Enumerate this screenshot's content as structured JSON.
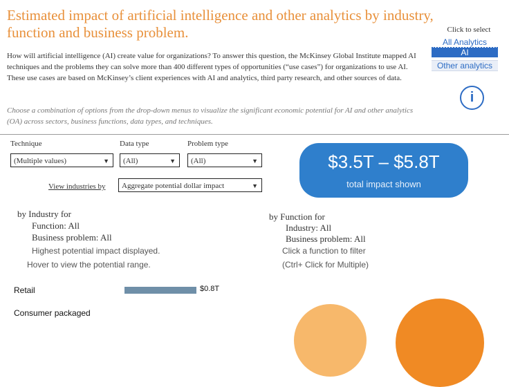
{
  "title": "Estimated impact of artificial intelligence and other analytics by industry, function and business problem.",
  "intro": "How will artificial intelligence (AI) create value for organizations? To answer this question, the McKinsey Global Institute mapped AI techniques and the problems they can solve more than 400 different types of opportunities (“use cases”) for organizations to use AI. These use cases are based on McKinsey’s client experiences with AI and analytics, third party research, and other sources of data.",
  "hint": "Choose a combination of options from the drop-down menus to visualize the significant economic potential for AI and other analytics (OA) across sectors, business functions, data types, and techniques.",
  "selector": {
    "caption": "Click to select",
    "options": [
      "All Analytics",
      "AI",
      "Other analytics"
    ],
    "selected": "AI"
  },
  "info_icon": "info-icon",
  "filters": {
    "technique": {
      "label": "Technique",
      "value": "(Multiple values)"
    },
    "data_type": {
      "label": "Data type",
      "value": "(All)"
    },
    "problem_type": {
      "label": "Problem type",
      "value": "(All)"
    },
    "view_by": {
      "label": "View industries by",
      "value": "Aggregate potential dollar impact"
    }
  },
  "metric": {
    "value": "$3.5T – $5.8T",
    "caption": "total impact shown"
  },
  "industry_section": {
    "heading": "by Industry for",
    "function": "Function: All",
    "problem": "Business problem: All",
    "note1": "Highest potential impact displayed.",
    "note2": "Hover to view the potential range."
  },
  "function_section": {
    "heading": "by Function for",
    "industry": "Industry: All",
    "problem": "Business problem: All",
    "note1": "Click a function to filter",
    "note2": "(Ctrl+ Click for Multiple)"
  },
  "industries": [
    {
      "name": "Retail",
      "value_label": "$0.8T",
      "value": 0.8
    },
    {
      "name": "Consumer packaged",
      "value_label": "",
      "value": null
    }
  ],
  "colors": {
    "accent": "#e8903a",
    "brand_blue": "#2f7fcc",
    "bar": "#6f8fa8",
    "bubble_light": "#f7b86b",
    "bubble_dark": "#f08a24"
  }
}
